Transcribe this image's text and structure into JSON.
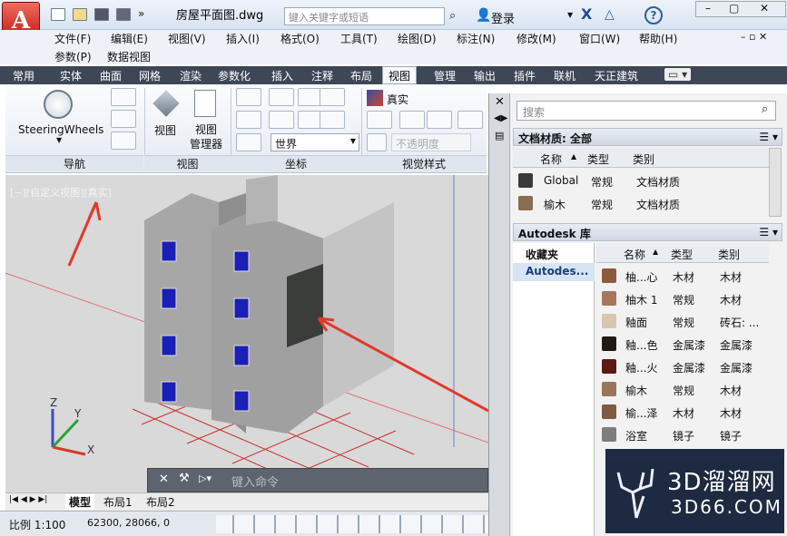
{
  "app": {
    "title": "房屋平面图.dwg",
    "search_placeholder": "键入关键字或短语",
    "login": "登录",
    "help": "?"
  },
  "menu": {
    "row1": [
      "文件(F)",
      "编辑(E)",
      "视图(V)",
      "插入(I)",
      "格式(O)",
      "工具(T)",
      "绘图(D)",
      "标注(N)",
      "修改(M)",
      "窗口(W)",
      "帮助(H)"
    ],
    "row2": [
      "参数(P)",
      "数据视图"
    ]
  },
  "tabs": [
    "常用",
    "实体",
    "曲面",
    "网格",
    "渲染",
    "参数化",
    "插入",
    "注释",
    "布局",
    "视图",
    "管理",
    "输出",
    "插件",
    "联机",
    "天正建筑"
  ],
  "active_tab": "视图",
  "ribbon": {
    "nav": {
      "label": "SteeringWheels",
      "footer": "导航"
    },
    "views": {
      "view_label": "视图",
      "manager_label": "视图\n管理器",
      "manager_l1": "视图",
      "manager_l2": "管理器",
      "footer": "视图"
    },
    "coords": {
      "world": "世界",
      "footer": "坐标"
    },
    "visual": {
      "style_name": "真实",
      "opacity_placeholder": "不透明度",
      "footer": "视觉样式"
    }
  },
  "viewport": {
    "label": "[−][自定义视图][真实]",
    "axis_x": "X",
    "axis_y": "Y",
    "axis_z": "Z"
  },
  "command": {
    "placeholder": "键入命令"
  },
  "layout_tabs": [
    "模型",
    "布局1",
    "布局2"
  ],
  "status": {
    "scale": "比例 1:100",
    "coords": "62300, 28066, 0"
  },
  "palette": {
    "search_placeholder": "搜索",
    "doc_header": "文档材质: 全部",
    "doc_columns": [
      "名称",
      "类型",
      "类别"
    ],
    "doc_rows": [
      {
        "name": "Global",
        "type": "常规",
        "category": "文档材质",
        "color": "#3a3a3a"
      },
      {
        "name": "榆木",
        "type": "常规",
        "category": "文档材质",
        "color": "#8a6c52"
      }
    ],
    "lib_header": "Autodesk 库",
    "lib_tree": [
      "收藏夹",
      "Autodes..."
    ],
    "lib_columns": [
      "名称",
      "类型",
      "类别"
    ],
    "lib_rows": [
      {
        "name": "柚...心",
        "type": "木材",
        "category": "木材",
        "color": "#8e5a3c"
      },
      {
        "name": "柚木 1",
        "type": "常规",
        "category": "木材",
        "color": "#a8765a"
      },
      {
        "name": "釉面",
        "type": "常规",
        "category": "砖石: ...",
        "color": "#d9c6b0"
      },
      {
        "name": "釉...色",
        "type": "金属漆",
        "category": "金属漆",
        "color": "#1f1a18"
      },
      {
        "name": "釉...火",
        "type": "金属漆",
        "category": "金属漆",
        "color": "#5c1a14"
      },
      {
        "name": "榆木",
        "type": "常规",
        "category": "木材",
        "color": "#9b7559"
      },
      {
        "name": "榆...泽",
        "type": "木材",
        "category": "木材",
        "color": "#7e5a40"
      },
      {
        "name": "浴室",
        "type": "镜子",
        "category": "镜子",
        "color": "#7d7d7d"
      }
    ]
  },
  "watermark": {
    "brand": "3D溜溜网",
    "url": "3D66.COM"
  }
}
